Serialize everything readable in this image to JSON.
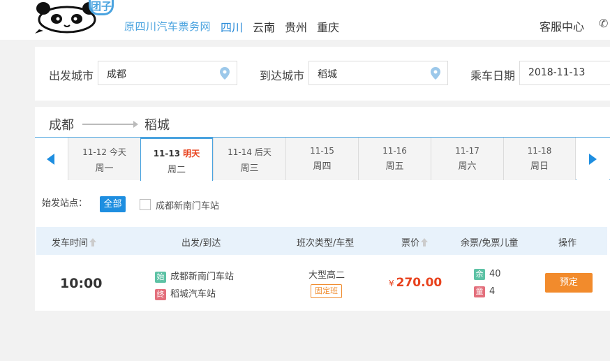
{
  "header": {
    "logo_badge": "团子",
    "site_name": "原四川汽车票务网",
    "nav": [
      "四川",
      "云南",
      "贵州",
      "重庆"
    ],
    "active_nav": "四川",
    "service_center": "客服中心"
  },
  "search": {
    "from_label": "出发城市",
    "from_value": "成都",
    "to_label": "到达城市",
    "to_value": "稻城",
    "date_label": "乘车日期",
    "date_value": "2018-11-13"
  },
  "route": {
    "from": "成都",
    "to": "稻城"
  },
  "dates": [
    {
      "date": "11-12",
      "note": "今天",
      "weekday": "周一"
    },
    {
      "date": "11-13",
      "note": "明天",
      "weekday": "周二",
      "active": true
    },
    {
      "date": "11-14",
      "note": "后天",
      "weekday": "周三"
    },
    {
      "date": "11-15",
      "note": "",
      "weekday": "周四"
    },
    {
      "date": "11-16",
      "note": "",
      "weekday": "周五"
    },
    {
      "date": "11-17",
      "note": "",
      "weekday": "周六"
    },
    {
      "date": "11-18",
      "note": "",
      "weekday": "周日"
    }
  ],
  "station_filter": {
    "label": "始发站点：",
    "all_button": "全部",
    "option": "成都新南门车站"
  },
  "table": {
    "headers": {
      "time": "发车时间",
      "route": "出发/到达",
      "type": "班次类型/车型",
      "price": "票价",
      "seats": "余票/免票儿童",
      "action": "操作"
    },
    "rows": [
      {
        "time": "10:00",
        "start_tag": "始",
        "start": "成都新南门车站",
        "end_tag": "终",
        "end": "稻城汽车站",
        "bus_type": "大型高二",
        "schedule": "固定班",
        "currency": "¥",
        "price": "270.00",
        "seat_tag": "余",
        "seats": "40",
        "child_tag": "童",
        "child": "4",
        "action": "预定"
      }
    ]
  },
  "colors": {
    "brand_blue": "#4aa3df",
    "active_blue": "#1e8ee0",
    "price_red": "#e8421d",
    "book_orange": "#f28b2c"
  },
  "icons": {
    "logo": "panda-logo-icon",
    "phone": "phone-icon",
    "location": "location-pin-icon",
    "prev": "arrow-left-icon",
    "next": "arrow-right-icon",
    "sort": "sort-up-icon"
  }
}
